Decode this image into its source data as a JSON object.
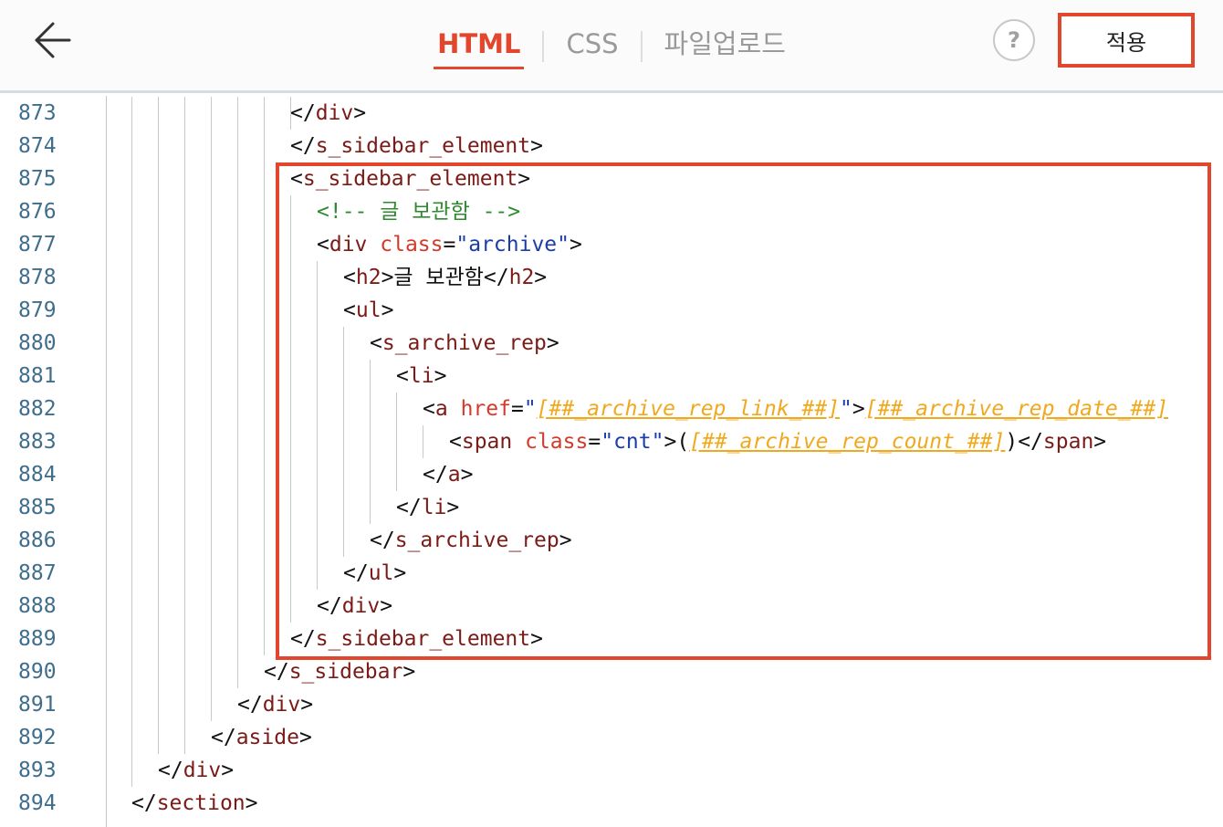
{
  "header": {
    "back_icon": "arrow-left-icon",
    "tabs": [
      {
        "label": "HTML",
        "active": true
      },
      {
        "label": "CSS",
        "active": false
      },
      {
        "label": "파일업로드",
        "active": false
      }
    ],
    "help_label": "?",
    "apply_label": "적용"
  },
  "colors": {
    "accent": "#e2472d",
    "line_number": "#3f6e8c",
    "tag": "#7b1a16",
    "attribute": "#d33a2a",
    "string": "#1b3ea6",
    "comment": "#2e8a2e",
    "template_variable": "#f0a91e"
  },
  "code_lines": [
    {
      "ln": "873",
      "segments": [
        [
          "p",
          "</"
        ],
        [
          "t",
          "div"
        ],
        [
          "p",
          ">"
        ]
      ]
    },
    {
      "ln": "874",
      "segments": [
        [
          "p",
          "</"
        ],
        [
          "t",
          "s_sidebar_element"
        ],
        [
          "p",
          ">"
        ]
      ]
    },
    {
      "ln": "875",
      "segments": [
        [
          "p",
          "<"
        ],
        [
          "t",
          "s_sidebar_element"
        ],
        [
          "p",
          ">"
        ]
      ]
    },
    {
      "ln": "876",
      "segments": [
        [
          "c",
          "<!-- 글 보관함 -->"
        ]
      ]
    },
    {
      "ln": "877",
      "segments": [
        [
          "p",
          "<"
        ],
        [
          "t",
          "div"
        ],
        [
          "p",
          " "
        ],
        [
          "a",
          "class"
        ],
        [
          "p",
          "="
        ],
        [
          "s",
          "\"archive\""
        ],
        [
          "p",
          ">"
        ]
      ]
    },
    {
      "ln": "878",
      "segments": [
        [
          "p",
          "<"
        ],
        [
          "t",
          "h2"
        ],
        [
          "p",
          ">글 보관함</"
        ],
        [
          "t",
          "h2"
        ],
        [
          "p",
          ">"
        ]
      ]
    },
    {
      "ln": "879",
      "segments": [
        [
          "p",
          "<"
        ],
        [
          "t",
          "ul"
        ],
        [
          "p",
          ">"
        ]
      ]
    },
    {
      "ln": "880",
      "segments": [
        [
          "p",
          "<"
        ],
        [
          "t",
          "s_archive_rep"
        ],
        [
          "p",
          ">"
        ]
      ]
    },
    {
      "ln": "881",
      "segments": [
        [
          "p",
          "<"
        ],
        [
          "t",
          "li"
        ],
        [
          "p",
          ">"
        ]
      ]
    },
    {
      "ln": "882",
      "segments": [
        [
          "p",
          "<"
        ],
        [
          "t",
          "a"
        ],
        [
          "p",
          " "
        ],
        [
          "a",
          "href"
        ],
        [
          "p",
          "="
        ],
        [
          "s",
          "\""
        ],
        [
          "v",
          "[##_archive_rep_link_##]"
        ],
        [
          "s",
          "\""
        ],
        [
          "p",
          ">"
        ],
        [
          "v",
          "[##_archive_rep_date_##]"
        ]
      ]
    },
    {
      "ln": "883",
      "segments": [
        [
          "p",
          "<"
        ],
        [
          "t",
          "span"
        ],
        [
          "p",
          " "
        ],
        [
          "a",
          "class"
        ],
        [
          "p",
          "="
        ],
        [
          "s",
          "\"cnt\""
        ],
        [
          "p",
          ">("
        ],
        [
          "v",
          "[##_archive_rep_count_##]"
        ],
        [
          "p",
          ")</"
        ],
        [
          "t",
          "span"
        ],
        [
          "p",
          ">"
        ]
      ]
    },
    {
      "ln": "884",
      "segments": [
        [
          "p",
          "</"
        ],
        [
          "t",
          "a"
        ],
        [
          "p",
          ">"
        ]
      ]
    },
    {
      "ln": "885",
      "segments": [
        [
          "p",
          "</"
        ],
        [
          "t",
          "li"
        ],
        [
          "p",
          ">"
        ]
      ]
    },
    {
      "ln": "886",
      "segments": [
        [
          "p",
          "</"
        ],
        [
          "t",
          "s_archive_rep"
        ],
        [
          "p",
          ">"
        ]
      ]
    },
    {
      "ln": "887",
      "segments": [
        [
          "p",
          "</"
        ],
        [
          "t",
          "ul"
        ],
        [
          "p",
          ">"
        ]
      ]
    },
    {
      "ln": "888",
      "segments": [
        [
          "p",
          "</"
        ],
        [
          "t",
          "div"
        ],
        [
          "p",
          ">"
        ]
      ]
    },
    {
      "ln": "889",
      "segments": [
        [
          "p",
          "</"
        ],
        [
          "t",
          "s_sidebar_element"
        ],
        [
          "p",
          ">"
        ]
      ]
    },
    {
      "ln": "890",
      "segments": [
        [
          "p",
          "</"
        ],
        [
          "t",
          "s_sidebar"
        ],
        [
          "p",
          ">"
        ]
      ]
    },
    {
      "ln": "891",
      "segments": [
        [
          "p",
          "</"
        ],
        [
          "t",
          "div"
        ],
        [
          "p",
          ">"
        ]
      ]
    },
    {
      "ln": "892",
      "segments": [
        [
          "p",
          "</"
        ],
        [
          "t",
          "aside"
        ],
        [
          "p",
          ">"
        ]
      ]
    },
    {
      "ln": "893",
      "segments": [
        [
          "p",
          "</"
        ],
        [
          "t",
          "div"
        ],
        [
          "p",
          ">"
        ]
      ]
    },
    {
      "ln": "894",
      "segments": [
        [
          "p",
          "</"
        ],
        [
          "t",
          "section"
        ],
        [
          "p",
          ">"
        ]
      ]
    }
  ]
}
